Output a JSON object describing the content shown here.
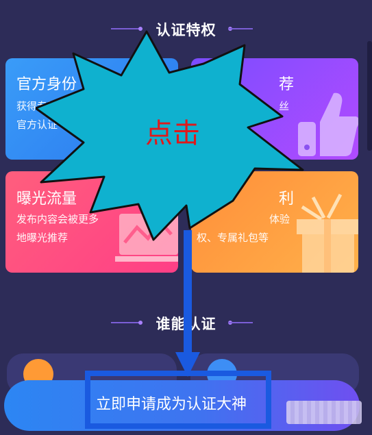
{
  "sections": {
    "privileges_title": "认证特权",
    "who_title": "谁能认证"
  },
  "cards": [
    {
      "title": "官方身份",
      "desc1": "获得专属大",
      "desc2": "官方认证",
      "color": "#2f8df4"
    },
    {
      "title": "荐",
      "desc1": "丝",
      "color": "#a348ff"
    },
    {
      "title": "曝光流量",
      "desc1": "发布内容会被更多",
      "desc2": "地曝光推荐",
      "color": "#ff4f82"
    },
    {
      "title": "利",
      "desc1": "体验",
      "desc2": "权、专属礼包等",
      "color": "#ff9a35"
    }
  ],
  "callout": {
    "text": "点击",
    "fill": "#0fb1cf",
    "text_color": "#e0191b"
  },
  "cta": {
    "label": "立即申请成为认证大神"
  },
  "colors": {
    "background": "#2d2c58",
    "arrow": "#1a5ae0"
  }
}
